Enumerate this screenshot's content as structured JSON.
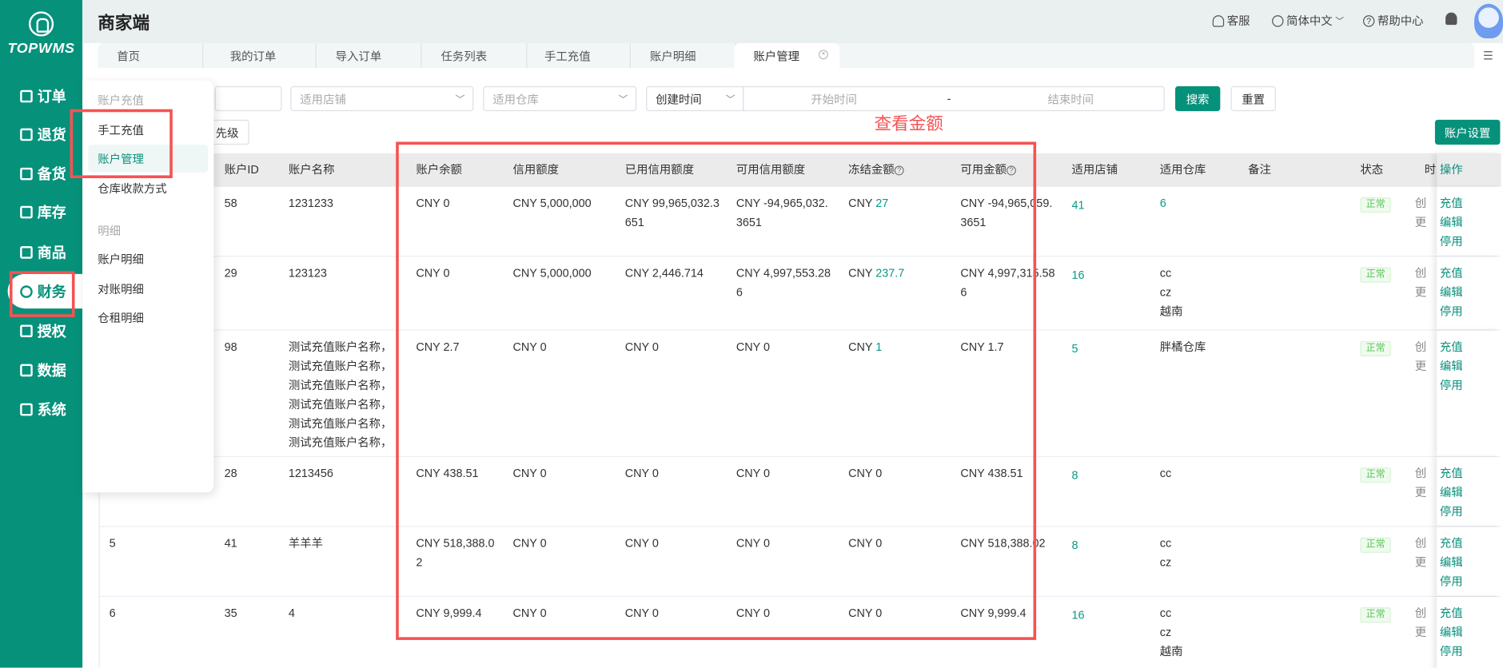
{
  "brand": {
    "logo_text": "TOPWMS"
  },
  "sidebar": {
    "items": [
      {
        "label": "订单",
        "icon": "order-icon"
      },
      {
        "label": "退货",
        "icon": "return-icon"
      },
      {
        "label": "备货",
        "icon": "stock-prep-icon"
      },
      {
        "label": "库存",
        "icon": "inventory-icon"
      },
      {
        "label": "商品",
        "icon": "product-icon"
      },
      {
        "label": "财务",
        "icon": "finance-icon",
        "active": true
      },
      {
        "label": "授权",
        "icon": "auth-icon"
      },
      {
        "label": "数据",
        "icon": "data-icon"
      },
      {
        "label": "系统",
        "icon": "system-icon"
      }
    ]
  },
  "header": {
    "title": "商家端",
    "service": "客服",
    "language": "简体中文",
    "help": "帮助中心"
  },
  "tabs": [
    {
      "label": "首页"
    },
    {
      "label": "我的订单"
    },
    {
      "label": "导入订单"
    },
    {
      "label": "任务列表"
    },
    {
      "label": "手工充值"
    },
    {
      "label": "账户明细"
    },
    {
      "label": "账户管理",
      "active": true
    }
  ],
  "filters": {
    "shop_placeholder": "适用店铺",
    "warehouse_placeholder": "适用仓库",
    "time_type": "创建时间",
    "start_placeholder": "开始时间",
    "range_sep": "-",
    "end_placeholder": "结束时间",
    "search": "搜索",
    "reset": "重置",
    "priority_button": "先级",
    "account_settings": "账户设置"
  },
  "popup_menu": {
    "group1": "账户充值",
    "items1": [
      "手工充值",
      "账户管理",
      "仓库收款方式"
    ],
    "group2": "明细",
    "items2": [
      "账户明细",
      "对账明细",
      "仓租明细"
    ]
  },
  "annotation": "查看金额",
  "table": {
    "columns": [
      "",
      "账户ID",
      "账户名称",
      "账户余额",
      "信用额度",
      "已用信用额度",
      "可用信用额度",
      "冻结金额",
      "可用金额",
      "适用店铺",
      "适用仓库",
      "备注",
      "状态",
      "时",
      "操作"
    ],
    "status_label": "正常",
    "time_labels": [
      "创",
      "更"
    ],
    "actions": [
      "充值",
      "编辑",
      "停用"
    ],
    "rows": [
      {
        "serial": "",
        "id": "58",
        "name": "1231233",
        "balance": "CNY 0",
        "credit": "CNY 5,000,000",
        "used_credit": "CNY 99,965,032.3651",
        "avail_credit": "CNY -94,965,032.3651",
        "frozen_prefix": "CNY ",
        "frozen": "27",
        "frozen_link": true,
        "available": "CNY -94,965,059.3651",
        "shops": "41",
        "warehouses": [
          "6"
        ],
        "warehouse_link": true
      },
      {
        "serial": "",
        "id": "29",
        "name": "123123",
        "balance": "CNY 0",
        "credit": "CNY 5,000,000",
        "used_credit": "CNY 2,446.714",
        "avail_credit": "CNY 4,997,553.286",
        "frozen_prefix": "CNY ",
        "frozen": "237.7",
        "frozen_link": true,
        "available": "CNY 4,997,315.586",
        "shops": "16",
        "warehouses": [
          "cc",
          "cz",
          "越南"
        ]
      },
      {
        "serial": "",
        "id": "98",
        "name": "测试充值账户名称，测试充值账户名称，测试充值账户名称，测试充值账户名称，测试充值账户名称，测试充值账户名称，",
        "balance": "CNY 2.7",
        "credit": "CNY 0",
        "used_credit": "CNY 0",
        "avail_credit": "CNY 0",
        "frozen_prefix": "CNY ",
        "frozen": "1",
        "frozen_link": true,
        "available": "CNY 1.7",
        "shops": "5",
        "warehouses": [
          "胖橘仓库"
        ]
      },
      {
        "serial": "",
        "id": "28",
        "name": "1213456",
        "balance": "CNY 438.51",
        "credit": "CNY 0",
        "used_credit": "CNY 0",
        "avail_credit": "CNY 0",
        "frozen_prefix": "CNY ",
        "frozen": "0",
        "frozen_link": false,
        "available": "CNY 438.51",
        "shops": "8",
        "warehouses": [
          "cc"
        ]
      },
      {
        "serial": "5",
        "id": "41",
        "name": "羊羊羊",
        "balance": "CNY 518,388.02",
        "credit": "CNY 0",
        "used_credit": "CNY 0",
        "avail_credit": "CNY 0",
        "frozen_prefix": "CNY ",
        "frozen": "0",
        "frozen_link": false,
        "available": "CNY 518,388.02",
        "shops": "8",
        "warehouses": [
          "cc",
          "cz"
        ]
      },
      {
        "serial": "6",
        "id": "35",
        "name": "4",
        "balance": "CNY 9,999.4",
        "credit": "CNY 0",
        "used_credit": "CNY 0",
        "avail_credit": "CNY 0",
        "frozen_prefix": "CNY ",
        "frozen": "0",
        "frozen_link": false,
        "available": "CNY 9,999.4",
        "shops": "16",
        "warehouses": [
          "cc",
          "cz",
          "越南"
        ]
      }
    ]
  },
  "colors": {
    "brand": "#06917b",
    "annotation": "#f55353"
  }
}
